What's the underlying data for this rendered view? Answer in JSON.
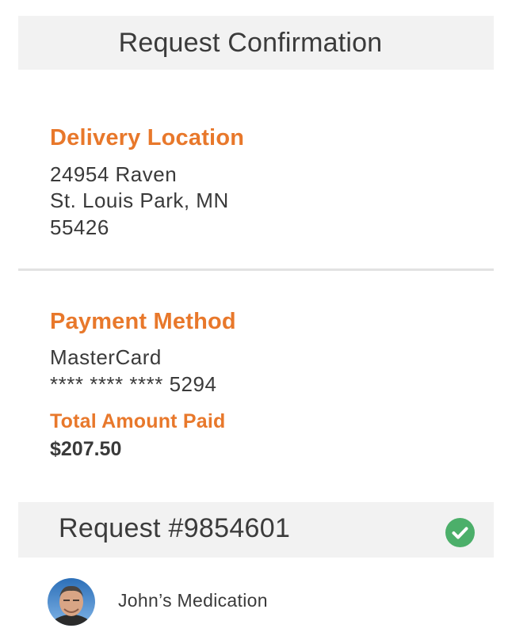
{
  "header": {
    "title": "Request Confirmation"
  },
  "delivery": {
    "title": "Delivery Location",
    "address_line1": "24954 Raven",
    "address_line2": "St. Louis Park, MN",
    "address_line3": "55426"
  },
  "payment": {
    "title": "Payment Method",
    "card_type": "MasterCard",
    "card_number": "**** **** **** 5294",
    "total_label": "Total Amount Paid",
    "total_value": "$207.50"
  },
  "request": {
    "title": "Request #9854601",
    "status_icon": "check-circle-icon",
    "patient_name": "John’s Medication"
  },
  "colors": {
    "accent": "#e8782b",
    "success": "#4caf6a",
    "bar_background": "#f2f2f2",
    "text": "#3a3a3a"
  }
}
